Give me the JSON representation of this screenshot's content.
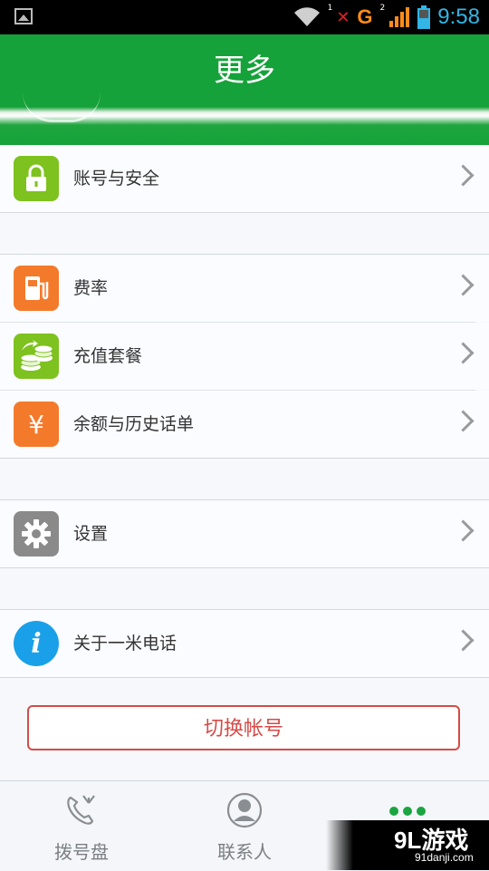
{
  "status_bar": {
    "time": "9:58",
    "network": "G",
    "sim1": "1",
    "sim2": "2"
  },
  "header": {
    "title": "更多"
  },
  "menu": [
    {
      "label": "账号与安全",
      "icon": "lock-icon",
      "color": "#7dc21e"
    },
    {
      "label": "费率",
      "icon": "fuel-pump-icon",
      "color": "#f47a2b"
    },
    {
      "label": "充值套餐",
      "icon": "coins-icon",
      "color": "#7dc21e"
    },
    {
      "label": "余额与历史话单",
      "icon": "yuan-icon",
      "color": "#f47a2b",
      "glyph": "¥"
    },
    {
      "label": "设置",
      "icon": "gear-icon",
      "color": "#8a8a8a"
    },
    {
      "label": "关于一米电话",
      "icon": "info-icon",
      "color": "#1aa0e8",
      "glyph": "i"
    }
  ],
  "switch_account": {
    "label": "切换帐号",
    "color": "#d44b48"
  },
  "tabs": [
    {
      "label": "拨号盘",
      "icon": "phone-icon"
    },
    {
      "label": "联系人",
      "icon": "contact-icon"
    },
    {
      "label": "",
      "icon": "more-dots-icon",
      "active_color": "#1aa541"
    }
  ],
  "watermark": {
    "logo": "9L游戏",
    "url": "91danji.com"
  }
}
